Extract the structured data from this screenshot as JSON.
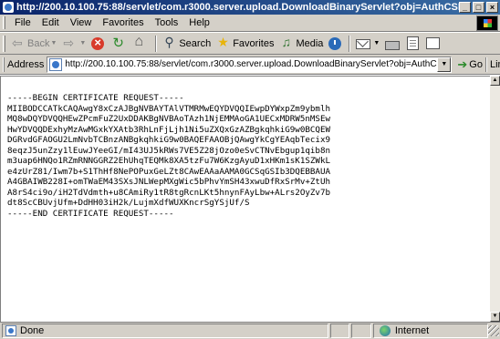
{
  "window": {
    "title": "http://200.10.100.75:88/servlet/com.r3000.server.upload.DownloadBinaryServlet?obj=AuthCSR - Mi...",
    "minimize_label": "_",
    "maximize_label": "□",
    "close_label": "×"
  },
  "menu": {
    "items": [
      "File",
      "Edit",
      "View",
      "Favorites",
      "Tools",
      "Help"
    ]
  },
  "toolbar": {
    "back_label": "Back",
    "search_label": "Search",
    "favorites_label": "Favorites",
    "media_label": "Media"
  },
  "address": {
    "label": "Address",
    "url": "http://200.10.100.75:88/servlet/com.r3000.server.upload.DownloadBinaryServlet?obj=AuthCSR",
    "go_label": "Go",
    "links_label": "Links"
  },
  "content": {
    "lines": [
      "-----BEGIN CERTIFICATE REQUEST-----",
      "MIIBODCCATkCAQAwgY8xCzAJBgNVBAYTAlVTMRMwEQYDVQQIEwpDYWxpZm9ybmlh",
      "MQ8wDQYDVQQHEwZPcmFuZ2UxDDAKBgNVBAoTAzh1NjEMMAoGA1UECxMDRW5nMSEw",
      "HwYDVQQDExhyMzAwMGxkYXAtb3RhLnFjLjh1Ni5uZXQxGzAZBgkqhkiG9w0BCQEW",
      "DGRvdGFAOGU2LmNvbTCBnzANBgkqhkiG9w0BAQEFAAOBjQAwgYkCgYEAqbTecix9",
      "8eqzJ5unZzy1lEuwJYeeGI/mI43UJ5kRWs7VE5Z28jOzo0eSvCTNvEbgup1qib8n",
      "m3uap6HNQo1RZmRNNGGRZ2EhUhqTEQMk8XA5tzFu7W6KzgAyuD1xHKm1sK1SZWkL",
      "e4zUrZ81/Iwm7b+S1ThHf8NePOPuxGeLZt8CAwEAAaAAMA0GCSqGSIb3DQEBBAUA",
      "A4GBAIWB228I+omTWaEM43SXsJNLWepMXgWic5bPhvYmSH43xwuDfRxSrMv+ZtUh",
      "A8rS4ci9o/iH2TdVdmth+u8CAmiRy1tR8tgRcnLKt5hnynFAyLbw+ALrs2OyZv7b",
      "dt8ScCBUvjUfm+DdHH03iH2k/LujmXdfWUXKncrSgYSjUf/S",
      "-----END CERTIFICATE REQUEST-----"
    ]
  },
  "status": {
    "text": "Done",
    "zone": "Internet"
  }
}
